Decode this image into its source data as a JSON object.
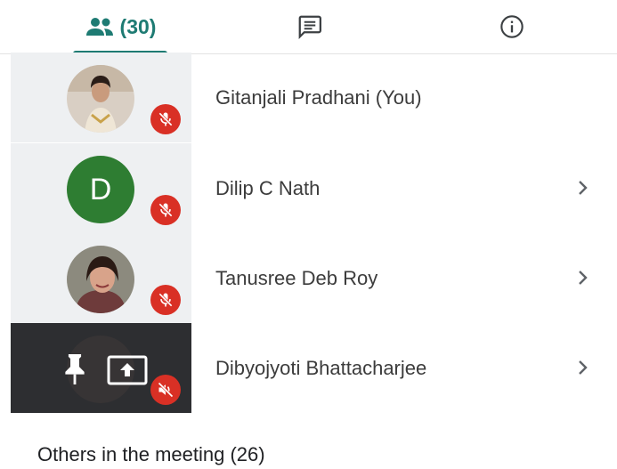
{
  "tabs": {
    "people": {
      "icon": "people-icon",
      "count_label": "(30)",
      "selected": true
    },
    "chat": {
      "icon": "chat-icon"
    },
    "info": {
      "icon": "info-icon"
    }
  },
  "participants": [
    {
      "name": "Gitanjali Pradhani (You)",
      "avatar": "photo",
      "muted": true,
      "has_chevron": false
    },
    {
      "name": "Dilip C Nath",
      "avatar": "letter",
      "avatar_letter": "D",
      "avatar_color": "#2e7d32",
      "muted": true,
      "has_chevron": true
    },
    {
      "name": "Tanusree Deb Roy",
      "avatar": "photo",
      "muted": true,
      "has_chevron": true
    },
    {
      "name": "Dibyojyoti Bhattacharjee",
      "avatar": "photo",
      "muted": true,
      "audio_off": true,
      "pinned_controls": true,
      "presenting": true,
      "has_chevron": true
    }
  ],
  "others_label": "Others in the meeting (26)",
  "colors": {
    "accent": "#1e7b73",
    "mute_red": "#d93025",
    "tile_bg": "#eef0f2",
    "tile_dark": "#2d2e31"
  }
}
